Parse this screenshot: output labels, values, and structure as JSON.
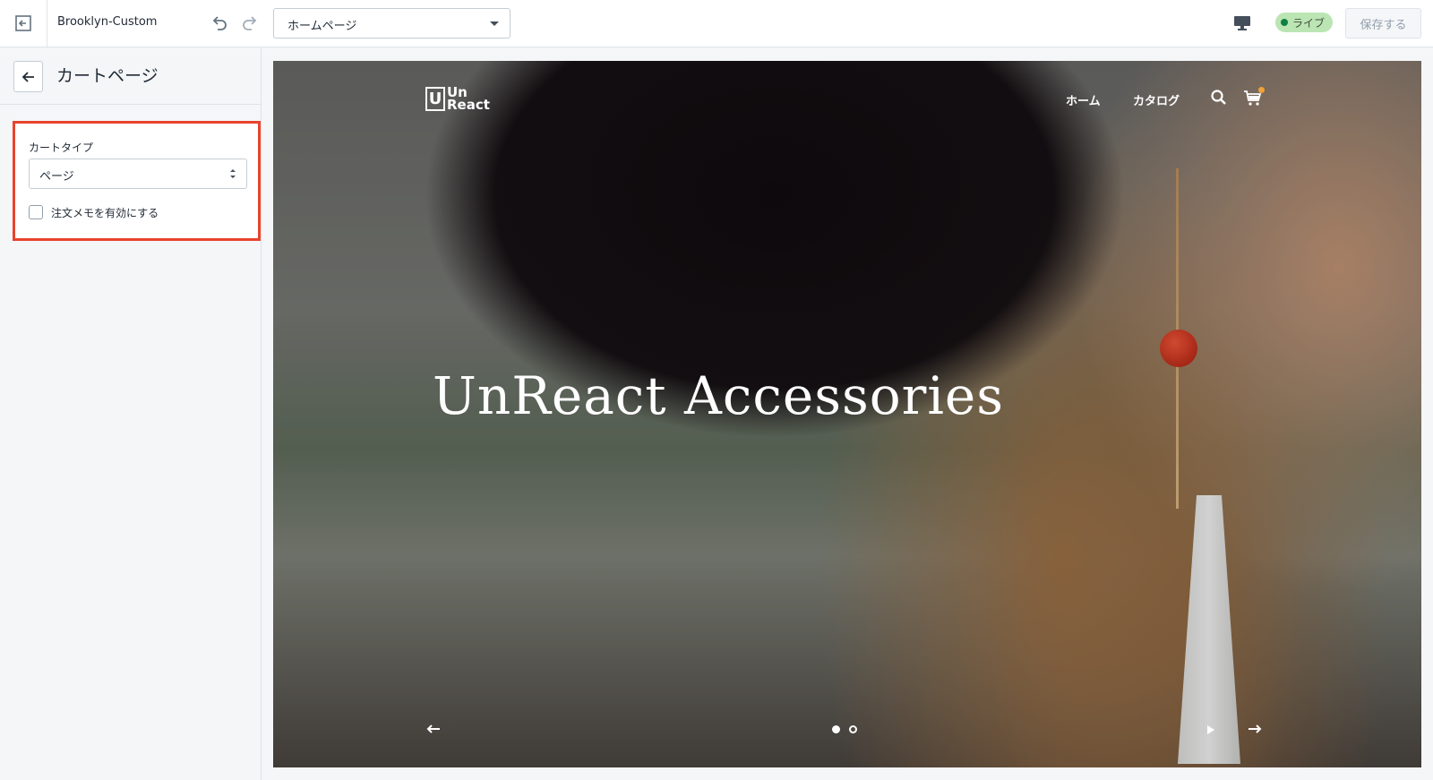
{
  "topbar": {
    "theme_name": "Brooklyn-Custom",
    "page_selector": {
      "selected": "ホームページ"
    },
    "status_badge": "ライブ",
    "save_label": "保存する"
  },
  "sidebar": {
    "title": "カートページ",
    "panel": {
      "cart_type_label": "カートタイプ",
      "cart_type_value": "ページ",
      "order_note_label": "注文メモを有効にする",
      "order_note_checked": false
    }
  },
  "preview": {
    "logo_text_line1": "Un",
    "logo_text_line2": "React",
    "logo_box_letter": "U",
    "nav": {
      "home": "ホーム",
      "catalog": "カタログ"
    },
    "hero_title": "UnReact Accessories",
    "slides_count": 2,
    "active_slide": 1
  },
  "colors": {
    "highlight": "#e8432d",
    "live_badge_bg": "#bbe5b3",
    "live_dot": "#108043"
  },
  "icons": [
    "exit-icon",
    "undo-icon",
    "redo-icon",
    "desktop-icon",
    "back-arrow-icon",
    "search-icon",
    "cart-icon",
    "arrow-left-icon",
    "arrow-right-icon",
    "play-icon"
  ]
}
